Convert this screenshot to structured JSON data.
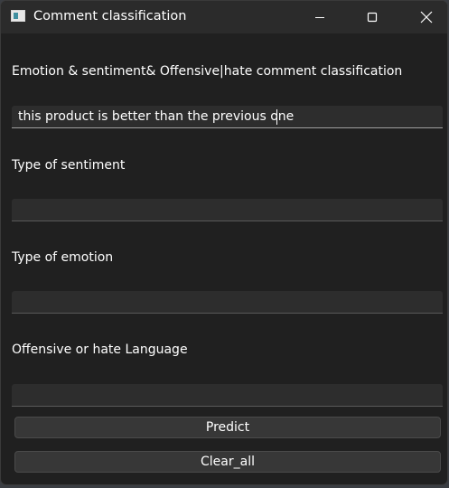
{
  "window": {
    "title": "Comment classification"
  },
  "main": {
    "heading": "Emotion & sentiment& Offensive|hate comment classification",
    "comment_input": {
      "value": "this product is better than the previous one",
      "placeholder": ""
    },
    "sentiment": {
      "label": "Type of sentiment",
      "value": ""
    },
    "emotion": {
      "label": "Type of emotion",
      "value": ""
    },
    "offensive": {
      "label": "Offensive or hate Language",
      "value": ""
    },
    "predict_label": "Predict",
    "clear_label": "Clear_all"
  },
  "colors": {
    "window_bg": "#202020",
    "titlebar_bg": "#2b2b2b",
    "field_bg": "#2d2d2d",
    "button_bg": "#373737",
    "text": "#ffffff"
  }
}
